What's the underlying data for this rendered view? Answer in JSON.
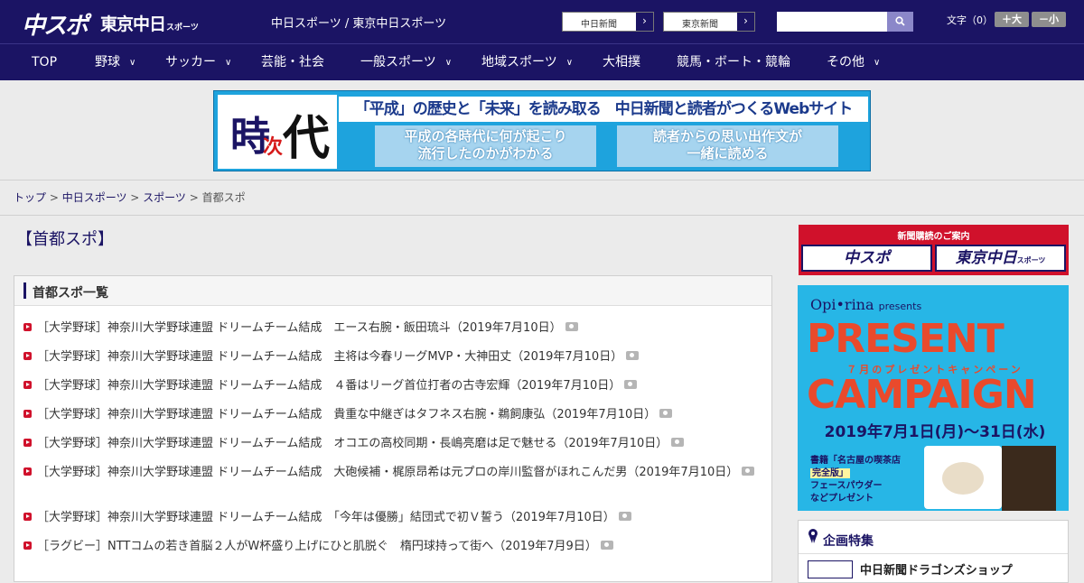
{
  "header": {
    "logo_chuspo": "中スポ",
    "logo_tokyo": "東京中日",
    "logo_tokyo_sub": "スポーツ",
    "site_name": "中日スポーツ / 東京中日スポーツ",
    "link_chunichi": "中日新聞",
    "link_tokyo": "東京新聞",
    "arrow": "›",
    "search_placeholder": "",
    "fontsize_label": "文字（0）",
    "fontsize_plus": "＋大",
    "fontsize_minus": "－小"
  },
  "nav": {
    "chevron": "∨",
    "items": [
      {
        "label": "TOP"
      },
      {
        "label": "野球"
      },
      {
        "label": "サッカー"
      },
      {
        "label": "芸能・社会"
      },
      {
        "label": "一般スポーツ"
      },
      {
        "label": "地域スポーツ"
      },
      {
        "label": "大相撲"
      },
      {
        "label": "競馬・ボート・競輪"
      },
      {
        "label": "その他"
      }
    ]
  },
  "banner": {
    "kanji_1": "時",
    "kanji_2": "次",
    "kanji_3": "代",
    "headline": "「平成」の歴史と「未来」を読み取る　中日新聞と読者がつくるWebサイト",
    "sub_left_1": "平成の各時代に何が起こり",
    "sub_left_2": "流行したのかがわかる",
    "sub_right_1": "読者からの思い出作文が",
    "sub_right_2": "一緒に読める"
  },
  "breadcrumb": {
    "home": "トップ",
    "sep": " > ",
    "chunichi": "中日スポーツ",
    "sports": "スポーツ",
    "current": "首都スポ"
  },
  "page_title": "【首都スポ】",
  "list": {
    "heading": "首都スポ一覧",
    "items": [
      {
        "text": "［大学野球］神奈川大学野球連盟 ドリームチーム結成　エース右腕・飯田琉斗（2019年7月10日）"
      },
      {
        "text": "［大学野球］神奈川大学野球連盟 ドリームチーム結成　主将は今春リーグMVP・大神田丈（2019年7月10日）"
      },
      {
        "text": "［大学野球］神奈川大学野球連盟 ドリームチーム結成　４番はリーグ首位打者の古寺宏輝（2019年7月10日）"
      },
      {
        "text": "［大学野球］神奈川大学野球連盟 ドリームチーム結成　貴重な中継ぎはタフネス右腕・鵜飼康弘（2019年7月10日）"
      },
      {
        "text": "［大学野球］神奈川大学野球連盟 ドリームチーム結成　オコエの高校同期・長嶋亮磨は足で魅せる（2019年7月10日）"
      },
      {
        "text": "［大学野球］神奈川大学野球連盟 ドリームチーム結成　大砲候補・梶原昂希は元プロの岸川監督がほれこんだ男（2019年7月10日）"
      },
      {
        "text": "［大学野球］神奈川大学野球連盟 ドリームチーム結成　「今年は優勝」結団式で初Ｖ誓う（2019年7月10日）"
      },
      {
        "text": "［ラグビー］NTTコムの若き首脳２人がW杯盛り上げにひと肌脱ぐ　楕円球持って街へ（2019年7月9日）"
      }
    ]
  },
  "sidebar": {
    "subscribe_title": "新聞購読のご案内",
    "subscribe_chuspo": "中スポ",
    "subscribe_tokyo": "東京中日",
    "subscribe_tokyo_sub": "スポーツ",
    "present_brand": "Opi•rina",
    "present_presents": "presents",
    "present_word": "PRESENT",
    "campaign_word": "CAMPAIGN",
    "campaign_sub": "７月のプレゼントキャンペーン",
    "campaign_dates": "2019年7月1日(月)〜31日(水)",
    "present_book_1": "書籍「名古屋の喫茶店",
    "present_book_2": "完全版」",
    "present_book_3": "フェースパウダー",
    "present_book_4": "などプレゼント",
    "feature_title": "企画特集",
    "feature_item": "中日新聞ドラゴンズショップ"
  },
  "colors": {
    "header_bg": "#1b1464",
    "accent_red": "#d0112b",
    "banner_blue": "#1ea3dd",
    "campaign_orange": "#e94a2c"
  }
}
